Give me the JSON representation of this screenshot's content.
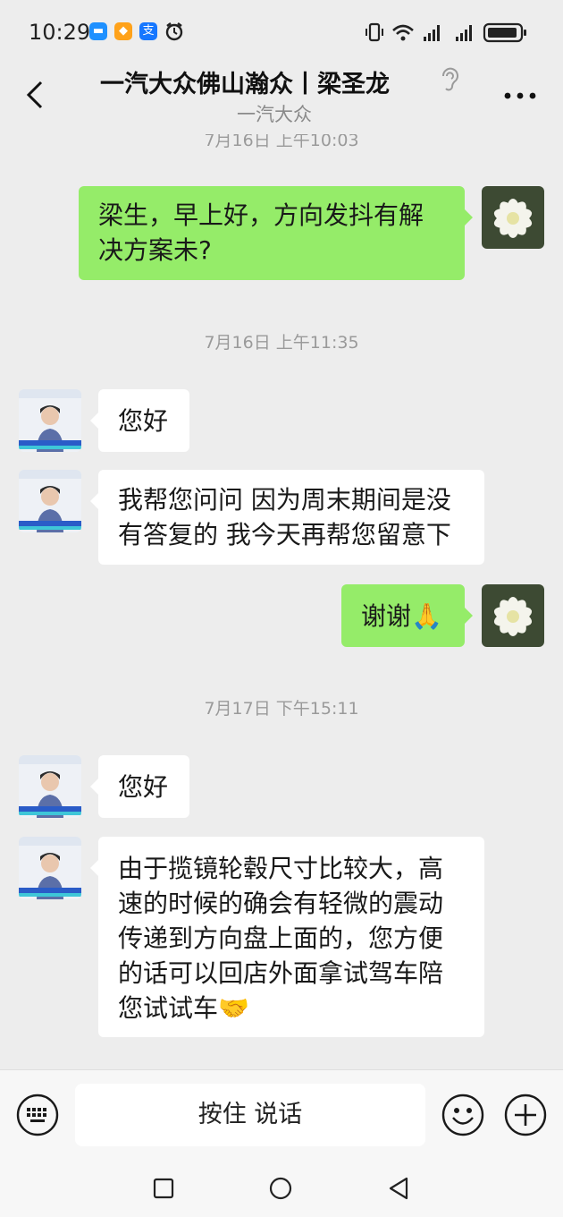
{
  "status_bar": {
    "time": "10:29",
    "battery_icon": "battery-icon",
    "wifi_icon": "wifi-icon"
  },
  "header": {
    "title": "一汽大众佛山瀚众丨梁圣龙",
    "subtitle": "一汽大众",
    "more_label": "…"
  },
  "chat": {
    "timestamps": {
      "t0": "7月16日 上午10:03",
      "t1": "7月16日 上午11:35",
      "t2": "7月17日 下午15:11"
    },
    "messages": [
      {
        "side": "out",
        "lines": [
          "梁生，早上好，方向发抖有解",
          "决方案未?"
        ]
      },
      {
        "side": "in",
        "lines": [
          "您好"
        ]
      },
      {
        "side": "in",
        "lines": [
          "我帮您问问 因为周末期间是没",
          "有答复的 我今天再帮您留意下"
        ]
      },
      {
        "side": "out",
        "lines": [
          "谢谢🙏"
        ]
      },
      {
        "side": "in",
        "lines": [
          "您好"
        ]
      },
      {
        "side": "in",
        "lines": [
          "由于揽镜轮毂尺寸比较大，高",
          "速的时候的确会有轻微的震动",
          "传递到方向盘上面的，您方便",
          "的话可以回店外面拿试驾车陪",
          "您试试车🤝"
        ]
      }
    ]
  },
  "input_bar": {
    "hold_to_talk": "按住 说话"
  },
  "colors": {
    "outgoing_bubble": "#95ec69",
    "incoming_bubble": "#ffffff",
    "background": "#ededed"
  }
}
